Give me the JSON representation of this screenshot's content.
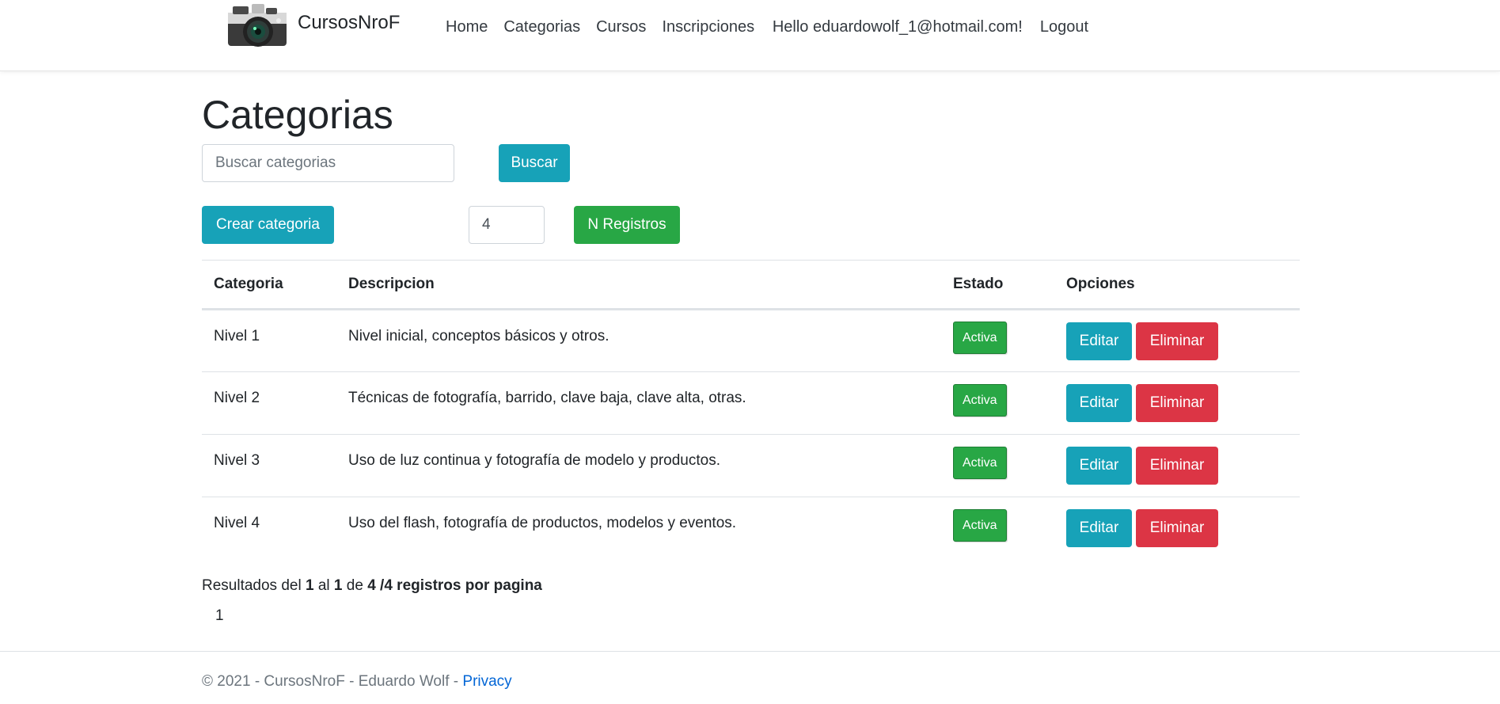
{
  "brand": {
    "name": "CursosNroF"
  },
  "nav": {
    "items": [
      {
        "label": "Home"
      },
      {
        "label": "Categorias"
      },
      {
        "label": "Cursos"
      },
      {
        "label": "Inscripciones"
      }
    ],
    "greeting": "Hello eduardowolf_1@hotmail.com!",
    "logout": "Logout"
  },
  "page": {
    "title": "Categorias",
    "search_placeholder": "Buscar categorias",
    "search_button": "Buscar",
    "create_button": "Crear categoria",
    "records_value": "4",
    "records_button": "N Registros"
  },
  "table": {
    "headers": [
      "Categoria",
      "Descripcion",
      "Estado",
      "Opciones"
    ],
    "rows": [
      {
        "categoria": "Nivel 1",
        "descripcion": "Nivel inicial, conceptos básicos y otros.",
        "estado": "Activa",
        "edit": "Editar",
        "delete": "Eliminar"
      },
      {
        "categoria": "Nivel 2",
        "descripcion": "Técnicas de fotografía, barrido, clave baja, clave alta, otras.",
        "estado": "Activa",
        "edit": "Editar",
        "delete": "Eliminar"
      },
      {
        "categoria": "Nivel 3",
        "descripcion": "Uso de luz continua y fotografía de modelo y productos.",
        "estado": "Activa",
        "edit": "Editar",
        "delete": "Eliminar"
      },
      {
        "categoria": "Nivel 4",
        "descripcion": "Uso del flash, fotografía de productos, modelos y eventos.",
        "estado": "Activa",
        "edit": "Editar",
        "delete": "Eliminar"
      }
    ]
  },
  "results": {
    "prefix": "Resultados del",
    "from": "1",
    "al": "al",
    "to": "1",
    "de": "de",
    "suffix": "4 /4 registros por pagina"
  },
  "pagination": {
    "current": "1"
  },
  "footer": {
    "text": "© 2021 - CursosNroF - Eduardo Wolf -",
    "link": "Privacy"
  },
  "colors": {
    "info": "#17a2b8",
    "success": "#28a745",
    "danger": "#dc3545",
    "link": "#0366d6"
  }
}
